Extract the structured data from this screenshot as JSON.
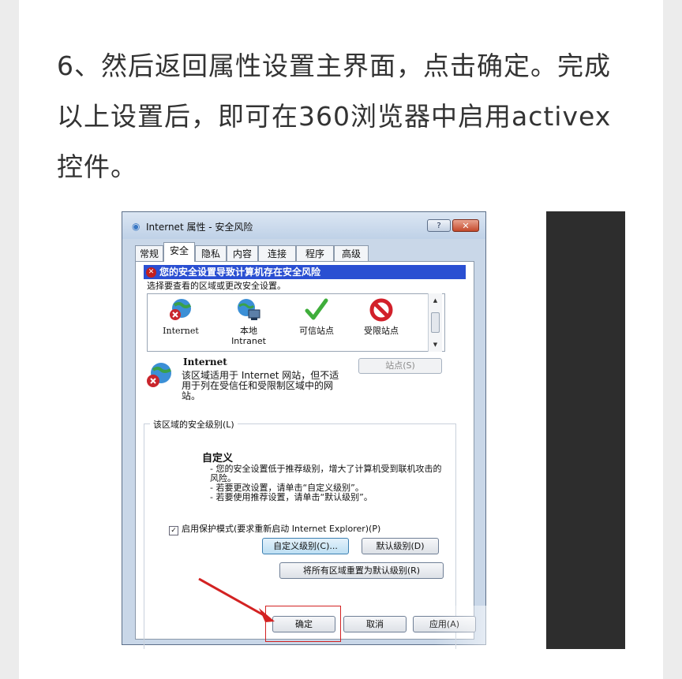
{
  "article": {
    "step_text": "6、然后返回属性设置主界面，点击确定。完成以上设置后，即可在360浏览器中启用activex控件。"
  },
  "dialog": {
    "title": "Internet 属性 - 安全风险",
    "help_btn": "?",
    "close_btn": "✕",
    "tabs": [
      "常规",
      "安全",
      "隐私",
      "内容",
      "连接",
      "程序",
      "高级"
    ],
    "active_tab": "安全",
    "warning_text": "您的安全设置导致计算机存在安全风险",
    "select_zone_label": "选择要查看的区域或更改安全设置。",
    "zones": [
      {
        "label": "Internet",
        "icon": "globe-blocked-icon"
      },
      {
        "label": "本地\nIntranet",
        "icon": "local-intranet-icon"
      },
      {
        "label": "可信站点",
        "icon": "trusted-check-icon"
      },
      {
        "label": "受限站点",
        "icon": "restricted-icon"
      }
    ],
    "zone_title": "Internet",
    "sites_btn": "站点(S)",
    "zone_description": "该区域适用于 Internet 网站，但不适用于列在受信任和受限制区域中的网站。",
    "security_level_group": "该区域的安全级别(L)",
    "level_name": "自定义",
    "level_description_lines": [
      "- 您的安全设置低于推荐级别，增大了计算机受到联机攻击的风险。",
      "- 若要更改设置，请单击“自定义级别”。",
      "- 若要使用推荐设置，请单击“默认级别”。"
    ],
    "protected_mode_checked": true,
    "protected_mode_label": "启用保护模式(要求重新启动 Internet Explorer)(P)",
    "custom_level_btn": "自定义级别(C)...",
    "default_level_btn": "默认级别(D)",
    "reset_all_btn": "将所有区域重置为默认级别(R)",
    "ok_btn": "确定",
    "cancel_btn": "取消",
    "apply_btn": "应用(A)"
  },
  "colors": {
    "annotation_red": "#d32222",
    "warning_bar": "#2a4fd2",
    "article_text": "#333333"
  }
}
